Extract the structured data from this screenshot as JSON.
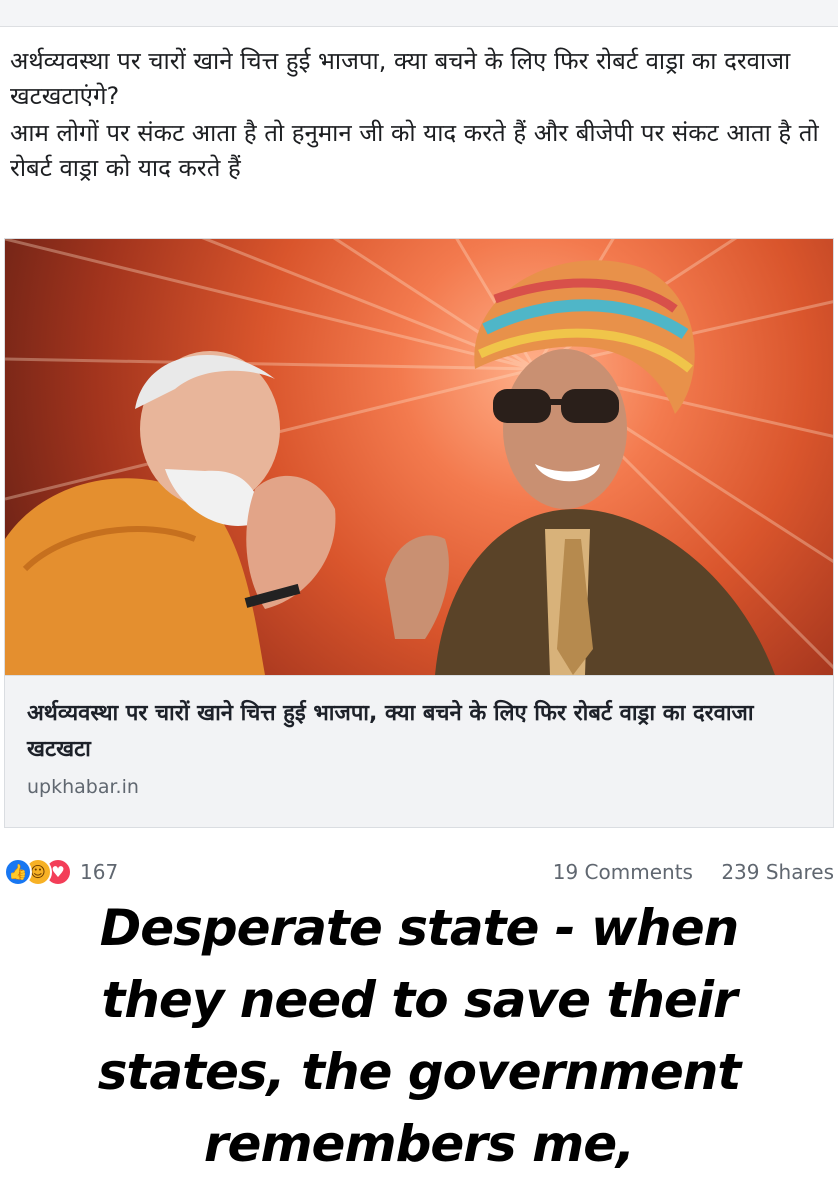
{
  "post": {
    "text_line_1": "अर्थव्यवस्था पर चारों खाने चित्त हुई भाजपा, क्या बचने के लिए फिर रोबर्ट वाड्रा का दरवाजा खटखटाएंगे?",
    "text_line_2": "आम लोगों पर संकट आता है तो हनुमान जी को याद करते हैं और बीजेपी पर संकट आता है तो रोबर्ट वाड्रा को याद करते हैं"
  },
  "link_card": {
    "title": "अर्थव्यवस्था पर चारों खाने चित्त हुई भाजपा, क्या बचने के लिए फिर रोबर्ट वाड्रा का दरवाजा खटखटा",
    "domain": "upkhabar.in"
  },
  "reactions": {
    "icons": [
      "like-icon",
      "haha-icon",
      "love-icon"
    ],
    "count": "167",
    "comments": "19 Comments",
    "shares": "239 Shares"
  },
  "meme": {
    "caption": "Desperate state - when they need to save their states, the government remembers me,"
  },
  "colors": {
    "like": "#1877f2",
    "haha": "#f7b125",
    "love": "#f33e58",
    "card_caption_bg": "#f2f3f5"
  }
}
